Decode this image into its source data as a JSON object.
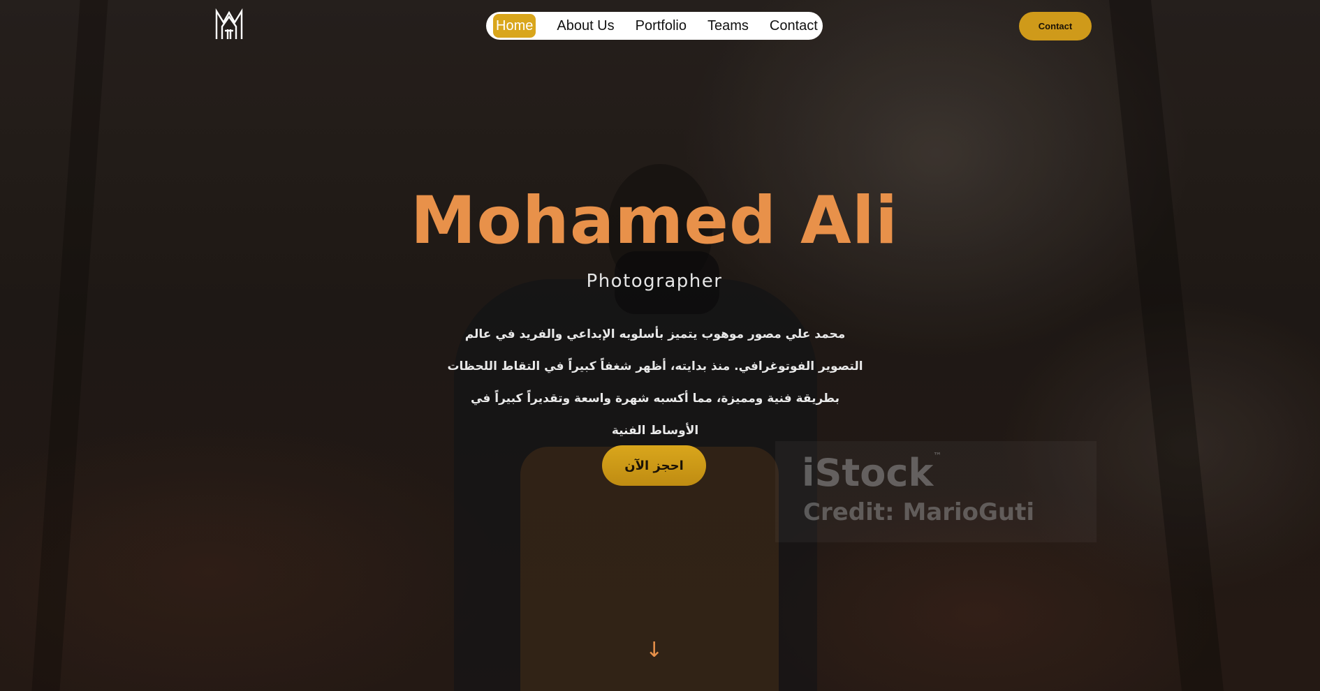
{
  "header": {
    "logo_icon": "mm-monogram-logo-icon",
    "nav": {
      "items": [
        {
          "label": "Home",
          "active": true
        },
        {
          "label": "About Us",
          "active": false
        },
        {
          "label": "Portfolio",
          "active": false
        },
        {
          "label": "Teams",
          "active": false
        },
        {
          "label": "Contact",
          "active": false
        }
      ]
    },
    "contact_button_label": "Contact"
  },
  "hero": {
    "name": "Mohamed Ali",
    "role": "Photographer",
    "bio": "محمد علي مصور موهوب يتميز بأسلوبه الإبداعي والفريد في عالم التصوير الفوتوغرافي. منذ بدايته، أظهر شغفاً كبيراً في التقاط اللحظات بطريقة فنية ومميزة، مما أكسبه شهرة واسعة وتقديراً كبيراً في الأوساط الفنية",
    "book_button_label": "احجز الآن",
    "scroll_icon": "arrow-down-icon",
    "scroll_glyph": "↓"
  },
  "watermark": {
    "brand": "iStock",
    "trademark": "™",
    "credit": "Credit: MarioGuti"
  },
  "colors": {
    "accent": "#d9a61c",
    "name_color": "#e8914a",
    "nav_bg": "#ffffff"
  }
}
